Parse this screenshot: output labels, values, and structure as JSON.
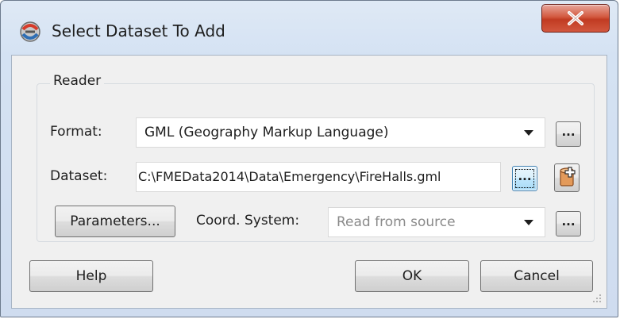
{
  "window": {
    "title": "Select Dataset To Add",
    "icon": "fme-workbench-icon",
    "close_icon": "close-icon"
  },
  "reader": {
    "group_label": "Reader",
    "format": {
      "label": "Format:",
      "value": "GML (Geography Markup Language)",
      "browse_label": "..."
    },
    "dataset": {
      "label": "Dataset:",
      "value": "C:\\FMEData2014\\Data\\Emergency\\FireHalls.gml",
      "browse_label": "...",
      "add_icon": "add-dataset-icon"
    },
    "parameters_label": "Parameters...",
    "coord_system": {
      "label": "Coord. System:",
      "value": "Read from source",
      "browse_label": "..."
    }
  },
  "buttons": {
    "help": "Help",
    "ok": "OK",
    "cancel": "Cancel"
  },
  "colors": {
    "close_red": "#c13b22",
    "focus_blue": "#3c7fb1"
  }
}
